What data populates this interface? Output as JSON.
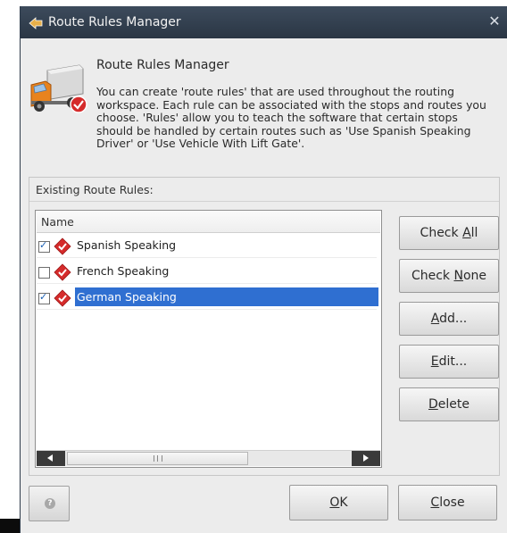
{
  "window": {
    "title": "Route Rules Manager"
  },
  "header": {
    "title": "Route Rules Manager",
    "description": "You can create 'route rules' that are used throughout the routing workspace. Each rule can be associated with the stops and routes you choose.  'Rules' allow you to teach the software that certain stops should be handled by certain routes such as 'Use Spanish Speaking Driver' or 'Use Vehicle With Lift Gate'."
  },
  "group": {
    "label": "Existing Route Rules:"
  },
  "list": {
    "column_header": "Name",
    "rows": [
      {
        "label": "Spanish Speaking",
        "checked": true,
        "selected": false
      },
      {
        "label": "French Speaking",
        "checked": false,
        "selected": false
      },
      {
        "label": "German Speaking",
        "checked": true,
        "selected": true
      }
    ]
  },
  "buttons": {
    "check_all": {
      "pre": "Check ",
      "key": "A",
      "post": "ll"
    },
    "check_none": {
      "pre": "Check ",
      "key": "N",
      "post": "one"
    },
    "add": {
      "pre": "",
      "key": "A",
      "post": "dd..."
    },
    "edit": {
      "pre": "",
      "key": "E",
      "post": "dit..."
    },
    "delete": {
      "pre": "",
      "key": "D",
      "post": "elete"
    },
    "ok": {
      "pre": "",
      "key": "O",
      "post": "K"
    },
    "close": {
      "pre": "",
      "key": "C",
      "post": "lose"
    }
  },
  "colors": {
    "titlebar": "#2f3b4a",
    "selection": "#2f6fd1",
    "rule_icon": "#d52b2b"
  },
  "icons": {
    "title": "route-rules-icon",
    "header": "truck-icon",
    "rule": "rule-badge-icon",
    "help": "help-icon"
  }
}
